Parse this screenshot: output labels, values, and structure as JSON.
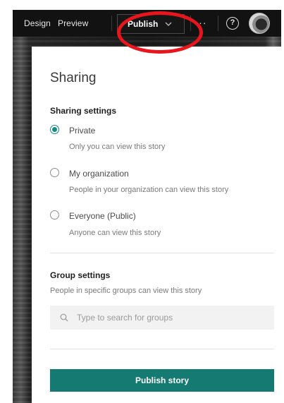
{
  "topbar": {
    "design_label": "Design",
    "preview_label": "Preview",
    "publish_label": "Publish",
    "more_label": "···",
    "help_label": "?"
  },
  "panel": {
    "title": "Sharing",
    "sharing_settings_heading": "Sharing settings",
    "options": [
      {
        "label": "Private",
        "description": "Only you can view this story",
        "selected": true
      },
      {
        "label": "My organization",
        "description": "People in your organization can view this story",
        "selected": false
      },
      {
        "label": "Everyone (Public)",
        "description": "Anyone can view this story",
        "selected": false
      }
    ],
    "group_settings_heading": "Group settings",
    "group_settings_description": "People in specific groups can view this story",
    "group_search_placeholder": "Type to search for groups",
    "publish_story_label": "Publish story"
  },
  "colors": {
    "accent": "#157a72",
    "annotation": "#e8151d",
    "topbar_bg": "#121212"
  }
}
